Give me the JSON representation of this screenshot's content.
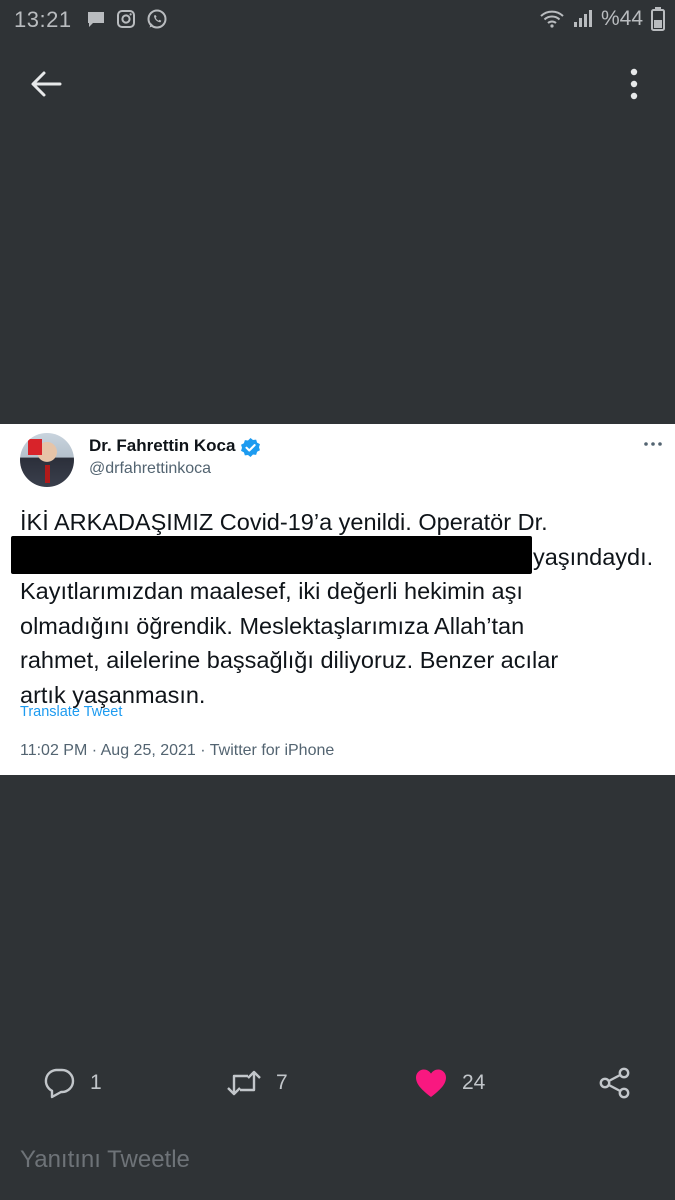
{
  "status_bar": {
    "time": "13:21",
    "battery": "%44",
    "left_icons": [
      "message-icon",
      "instagram-icon",
      "whatsapp-icon"
    ],
    "right_icons": [
      "wifi-icon",
      "signal-icon",
      "battery-icon"
    ]
  },
  "toolbar": {
    "back_icon": "arrow-left-icon",
    "menu_icon": "more-vertical-icon"
  },
  "tweet": {
    "display_name": "Dr. Fahrettin Koca",
    "handle": "@drfahrettinkoca",
    "verified": true,
    "text_lines": [
      "İKİ ARKADAŞIMIZ Covid-19’a yenildi. Operatör Dr.",
      "yaşındaydı.",
      "Kayıtlarımızdan maalesef, iki değerli hekimin aşı",
      "olmadığını öğrendik. Meslektaşlarımıza Allah’tan",
      "rahmet, ailelerine başsağlığı diliyoruz. Benzer acılar",
      "artık yaşanmasın."
    ],
    "translate_label": "Translate Tweet",
    "meta": "11:02 PM · Aug 25, 2021 · Twitter for iPhone"
  },
  "actions": {
    "reply_count": "1",
    "retweet_count": "7",
    "like_count": "24",
    "like_color": "#f91880"
  },
  "reply": {
    "placeholder": "Yanıtını Tweetle"
  },
  "colors": {
    "background": "#2f3336",
    "link": "#1d9bf0",
    "verified": "#1d9bf0"
  }
}
